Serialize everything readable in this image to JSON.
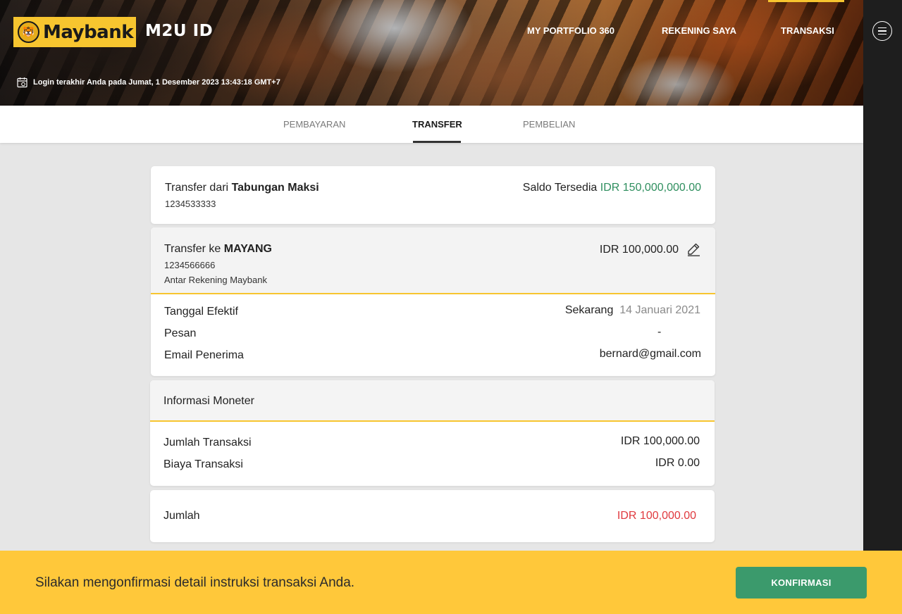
{
  "header": {
    "logo_text": "Maybank",
    "logo_emblem": "🐯",
    "product_name": "M2U ID",
    "nav": [
      {
        "label": "MY PORTFOLIO 360"
      },
      {
        "label": "REKENING SAYA"
      },
      {
        "label": "TRANSAKSI",
        "active": true
      }
    ],
    "last_login": "Login terakhir Anda pada Jumat, 1 Desember 2023 13:43:18 GMT+7",
    "icons": {
      "calendar": "calendar-icon",
      "menu": "hamburger-menu-icon"
    }
  },
  "subtabs": [
    {
      "label": "PEMBAYARAN"
    },
    {
      "label": "TRANSFER",
      "active": true
    },
    {
      "label": "PEMBELIAN"
    }
  ],
  "transfer_from": {
    "prefix": "Transfer dari",
    "account_name": "Tabungan Maksi",
    "account_number": "1234533333",
    "balance_label": "Saldo Tersedia",
    "balance_value": "IDR 150,000,000.00"
  },
  "transfer_to": {
    "prefix": "Transfer ke",
    "recipient_name": "MAYANG",
    "account_number": "1234566666",
    "transfer_type": "Antar Rekening Maybank",
    "amount": "IDR 100,000.00",
    "edit_icon": "pencil-icon",
    "details": {
      "effective_date_label": "Tanggal Efektif",
      "effective_date_mode": "Sekarang",
      "effective_date_value": "14 Januari 2021",
      "message_label": "Pesan",
      "message_value": "-",
      "email_label": "Email Penerima",
      "email_value": "bernard@gmail.com"
    }
  },
  "monetary": {
    "title": "Informasi Moneter",
    "transaction_amount_label": "Jumlah Transaksi",
    "transaction_amount_value": "IDR 100,000.00",
    "fee_label": "Biaya Transaksi",
    "fee_value": "IDR 0.00"
  },
  "total": {
    "label": "Jumlah",
    "value": "IDR 100,000.00"
  },
  "footer": {
    "message": "Silakan mengonfirmasi detail instruksi transaksi Anda.",
    "confirm_label": "KONFIRMASI"
  },
  "colors": {
    "brand_yellow": "#f7c52f",
    "footer_yellow": "#ffc83a",
    "confirm_green": "#3b9a6c",
    "balance_green": "#2f8f5f",
    "total_red": "#e0393e",
    "rail_dark": "#1e1e1e"
  }
}
